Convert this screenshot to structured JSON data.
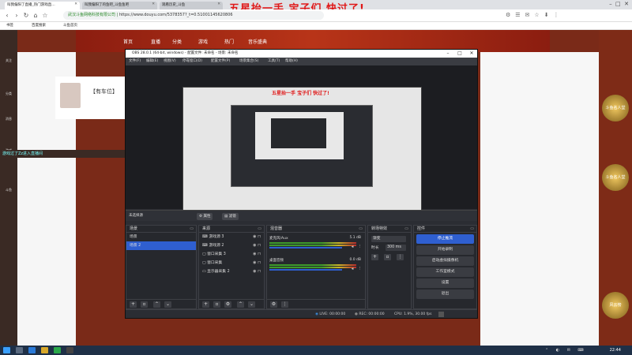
{
  "browser": {
    "tabs": [
      {
        "label": "叫我偏阳了直播_热门游戏直播_斗鱼"
      },
      {
        "label": "叫我偏阳了的鱼吧_斗鱼鱼吧"
      },
      {
        "label": "观看历史_斗鱼"
      }
    ],
    "url": "https://www.douyu.com/5378357?_t=0.51001145620806",
    "cert": "武汉斗鱼网络科技有限公司",
    "bookmarks": [
      "书签",
      "百度搜索",
      "斗鱼首页"
    ],
    "overlay_banner": "五星抬一手 宝子们 快过了!"
  },
  "douyu": {
    "nav": [
      "首页",
      "直播",
      "分类",
      "游戏",
      "热门",
      "音乐盛典"
    ],
    "side": [
      "关注",
      "分类",
      "消息",
      "游戏",
      "斗鱼"
    ],
    "room_title": "【有车位】",
    "chat_line": "游戏过了Zz进入直播间",
    "badges": [
      "斗鱼名人堂",
      "斗鱼名人堂",
      "风云榜"
    ]
  },
  "obs": {
    "title": "OBS 28.0.1 (64-bit, windows) - 配置文件: 未命名 - 场景: 未命名",
    "win_controls": [
      "–",
      "□",
      "✕"
    ],
    "menu": [
      "文件(F)",
      "编辑(E)",
      "视图(V)",
      "停靠窗口(D)",
      "配置文件(P)",
      "场景集合(S)",
      "工具(T)",
      "帮助(H)"
    ],
    "preview_banner": "五星抬一手 宝子们 快过了!",
    "source_status": "未选择源",
    "source_buttons": [
      "属性",
      "滤镜"
    ],
    "scenes": {
      "header": "场景",
      "items": [
        "场景",
        "场景 2"
      ],
      "selected": 1
    },
    "sources": {
      "header": "来源",
      "items": [
        "游戏源 3",
        "游戏源 2",
        "窗口采集 3",
        "窗口采集",
        "显示器采集 2"
      ]
    },
    "mixer": {
      "header": "混音器",
      "channels": [
        {
          "name": "麦克风/Aux",
          "db": "5.1 dB"
        },
        {
          "name": "桌面音频",
          "db": "0.0 dB"
        }
      ]
    },
    "transitions": {
      "header": "转场特效",
      "type": "渐变",
      "duration_label": "时长",
      "duration": "300 ms"
    },
    "controls": {
      "header": "控件",
      "buttons": [
        "停止推流",
        "开始录制",
        "启动虚拟摄像机",
        "工作室模式",
        "设置",
        "退出"
      ]
    },
    "status": {
      "live": "LIVE: 00:00:00",
      "rec": "REC: 00:00:00",
      "cpu": "CPU: 1.9%, 30.00 fps"
    }
  },
  "taskbar": {
    "time": "22:44"
  }
}
